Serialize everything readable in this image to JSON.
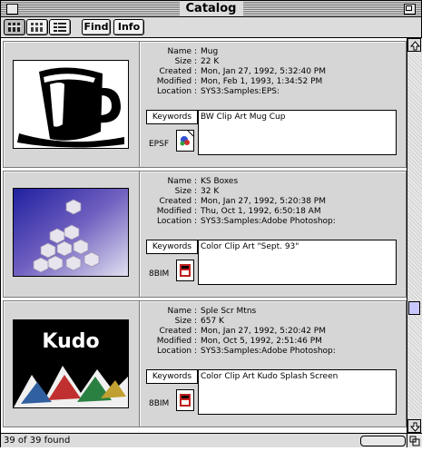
{
  "window": {
    "title": "Catalog"
  },
  "toolbar": {
    "find_label": "Find",
    "info_label": "Info"
  },
  "field_labels": {
    "name": "Name :",
    "size": "Size :",
    "created": "Created :",
    "modified": "Modified :",
    "location": "Location :"
  },
  "records": [
    {
      "name": "Mug",
      "size": "22 K",
      "created": "Mon, Jan 27, 1992, 5:32:40 PM",
      "modified": "Mon, Feb 1, 1993, 1:34:52 PM",
      "location": "SYS3:Samples:EPS:",
      "keywords_label": "Keywords",
      "keywords": "BW Clip Art Mug Cup",
      "file_type": "EPSF"
    },
    {
      "name": "KS Boxes",
      "size": "32 K",
      "created": "Mon, Jan 27, 1992, 5:20:38 PM",
      "modified": "Thu, Oct 1, 1992, 6:50:18 AM",
      "location": "SYS3:Samples:Adobe Photoshop:",
      "keywords_label": "Keywords",
      "keywords": "Color Clip Art \"Sept. 93\"",
      "file_type": "8BIM"
    },
    {
      "name": "Sple Scr Mtns",
      "size": "657 K",
      "created": "Mon, Jan 27, 1992, 5:20:42 PM",
      "modified": "Mon, Oct 5, 1992, 2:51:46 PM",
      "location": "SYS3:Samples:Adobe Photoshop:",
      "keywords_label": "Keywords",
      "keywords": "Color Clip Art Kudo Splash Screen",
      "file_type": "8BIM",
      "thumb_text": "Kudo"
    }
  ],
  "status": {
    "found_text": "39 of 39 found"
  }
}
